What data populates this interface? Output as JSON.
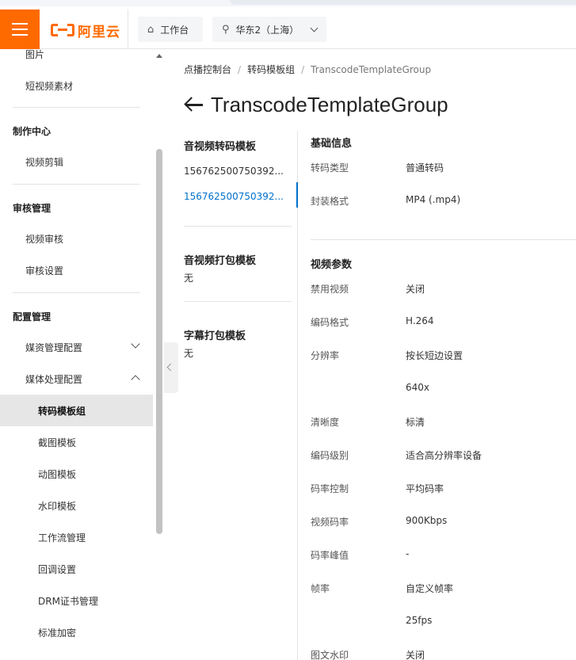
{
  "header": {
    "logo_text": "阿里云",
    "workbench_label": "工作台",
    "region_label": "华东2（上海）"
  },
  "sidebar": {
    "items_top": [
      {
        "label": "图片"
      },
      {
        "label": "短视频素材"
      }
    ],
    "sections": [
      {
        "title": "制作中心",
        "items": [
          "视频剪辑"
        ]
      },
      {
        "title": "审核管理",
        "items": [
          "视频审核",
          "审核设置"
        ]
      },
      {
        "title": "配置管理",
        "items": [
          "媒资管理配置",
          "媒体处理配置"
        ]
      }
    ],
    "media_processing_children": [
      "转码模板组",
      "截图模板",
      "动图模板",
      "水印模板",
      "工作流管理",
      "回调设置",
      "DRM证书管理",
      "标准加密"
    ]
  },
  "breadcrumb": {
    "items": [
      "点播控制台",
      "转码模板组",
      "TranscodeTemplateGroup"
    ]
  },
  "page": {
    "title": "TranscodeTemplateGroup"
  },
  "groups": {
    "av_transcode_title": "音视频转码模板",
    "av_transcode_items": [
      "156762500750392...",
      "156762500750392..."
    ],
    "av_package_title": "音视频打包模板",
    "av_package_value": "无",
    "subtitle_package_title": "字幕打包模板",
    "subtitle_package_value": "无"
  },
  "basic_info": {
    "title": "基础信息",
    "rows": [
      {
        "label": "转码类型",
        "value": "普通转码"
      },
      {
        "label": "封装格式",
        "value": "MP4 (.mp4)"
      }
    ]
  },
  "video_params": {
    "title": "视频参数",
    "rows": [
      {
        "label": "禁用视频",
        "value": "关闭"
      },
      {
        "label": "编码格式",
        "value": "H.264"
      },
      {
        "label": "分辨率",
        "value": "按长短边设置"
      },
      {
        "label": "",
        "value": "640x"
      },
      {
        "label": "清晰度",
        "value": "标清"
      },
      {
        "label": "编码级别",
        "value": "适合高分辨率设备"
      },
      {
        "label": "码率控制",
        "value": "平均码率"
      },
      {
        "label": "视频码率",
        "value": "900Kbps"
      },
      {
        "label": "码率峰值",
        "value": "-"
      },
      {
        "label": "帧率",
        "value": "自定义帧率"
      },
      {
        "label": "",
        "value": "25fps"
      },
      {
        "label": "图文水印",
        "value": "关闭"
      }
    ]
  },
  "colors": {
    "brand": "#ff6a00",
    "link": "#0070cc"
  }
}
